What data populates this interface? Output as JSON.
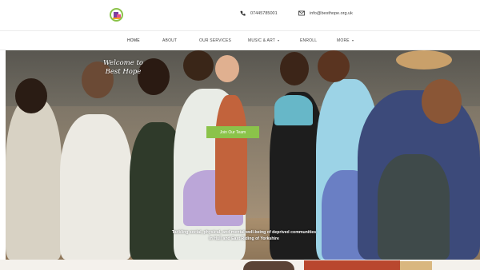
{
  "header": {
    "phone": "07445785001",
    "email": "info@besthope.org.uk"
  },
  "nav": {
    "items": [
      {
        "label": "HOME",
        "dropdown": false,
        "active": true
      },
      {
        "label": "ABOUT",
        "dropdown": false,
        "active": false
      },
      {
        "label": "OUR SERVICES",
        "dropdown": false,
        "active": false
      },
      {
        "label": "MUSIC & ART",
        "dropdown": true,
        "active": false
      },
      {
        "label": "ENROLL",
        "dropdown": false,
        "active": false
      },
      {
        "label": "MORE",
        "dropdown": true,
        "active": false
      }
    ]
  },
  "hero": {
    "title_line1": "Welcome to",
    "title_line2": "Best Hope",
    "button_label": "Join Our Team",
    "subtitle_line1": "Tackling social, physical, and mental well-being of deprived communities",
    "subtitle_line2": "in Hull and East Riding of Yorkshire"
  },
  "colors": {
    "accent_green": "#8bc34a",
    "logo_purple": "#7b3fa0",
    "logo_pink": "#e94e8a"
  },
  "icons": {
    "phone": "phone-icon",
    "email": "mail-icon",
    "caret": "chevron-down-icon"
  }
}
